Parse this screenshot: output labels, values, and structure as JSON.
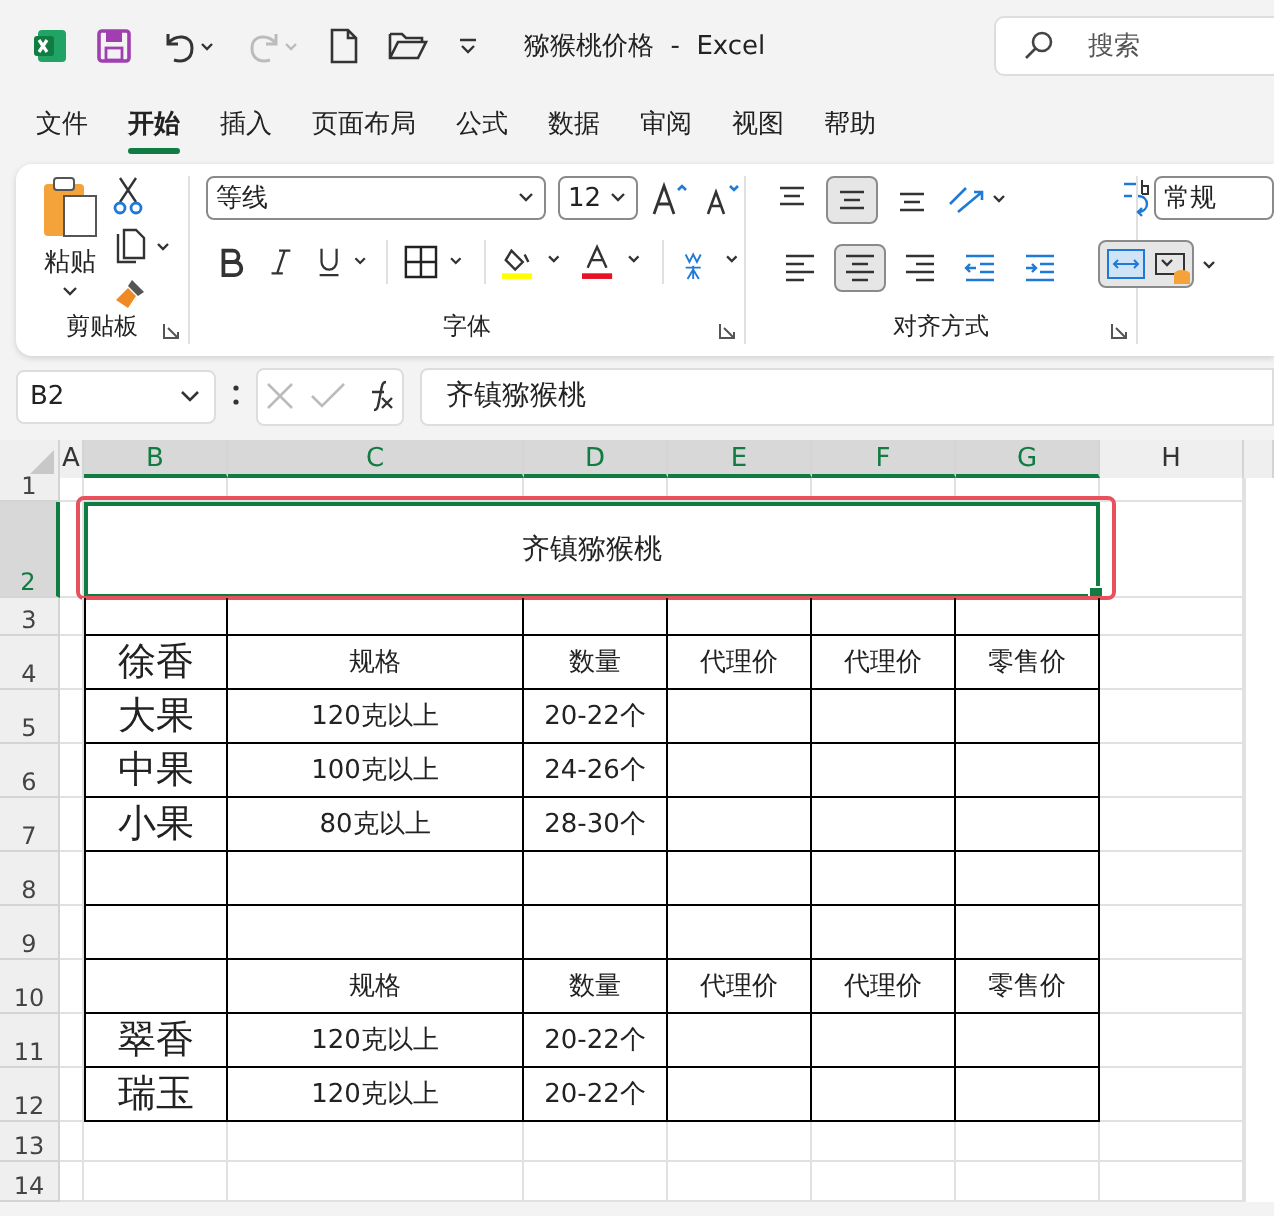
{
  "title_bar": {
    "document": "猕猴桃价格",
    "separator": "-",
    "app": "Excel",
    "search": {
      "placeholder": "搜索"
    }
  },
  "menu_tabs": [
    {
      "label": "文件",
      "selected": false
    },
    {
      "label": "开始",
      "selected": true
    },
    {
      "label": "插入",
      "selected": false
    },
    {
      "label": "页面布局",
      "selected": false
    },
    {
      "label": "公式",
      "selected": false
    },
    {
      "label": "数据",
      "selected": false
    },
    {
      "label": "审阅",
      "selected": false
    },
    {
      "label": "视图",
      "selected": false
    },
    {
      "label": "帮助",
      "selected": false
    }
  ],
  "ribbon": {
    "clipboard": {
      "paste": "粘贴",
      "group": "剪贴板"
    },
    "font": {
      "name": "等线",
      "size": "12",
      "group": "字体"
    },
    "alignment": {
      "group": "对齐方式",
      "vertical": [
        {
          "kind": "top",
          "selected": false
        },
        {
          "kind": "middle",
          "selected": true
        },
        {
          "kind": "bottom",
          "selected": false
        }
      ],
      "horizontal": [
        {
          "kind": "left",
          "selected": false
        },
        {
          "kind": "center",
          "selected": true
        },
        {
          "kind": "right",
          "selected": false
        },
        {
          "kind": "outdent",
          "selected": false
        },
        {
          "kind": "indent",
          "selected": false
        }
      ],
      "merge": {
        "selected": true
      }
    },
    "number": {
      "format": "常规"
    }
  },
  "formula_bar": {
    "name_box": "B2",
    "value": "齐镇猕猴桃"
  },
  "sheet": {
    "columns": [
      {
        "label": "A",
        "selected": false
      },
      {
        "label": "B",
        "selected": true
      },
      {
        "label": "C",
        "selected": true
      },
      {
        "label": "D",
        "selected": true
      },
      {
        "label": "E",
        "selected": true
      },
      {
        "label": "F",
        "selected": true
      },
      {
        "label": "G",
        "selected": true
      },
      {
        "label": "H",
        "selected": false
      }
    ],
    "rows": [
      {
        "number": "1",
        "selected": false,
        "bordered": false,
        "cells": [
          null,
          null,
          null,
          null,
          null,
          null
        ]
      },
      {
        "number": "2",
        "selected": true,
        "highlight": true,
        "merged": "齐镇猕猴桃"
      },
      {
        "number": "3",
        "selected": false,
        "bordered": true,
        "cells": [
          null,
          null,
          null,
          null,
          null,
          null
        ]
      },
      {
        "number": "4",
        "selected": false,
        "bordered": true,
        "cells": [
          {
            "text": "徐香",
            "large": true
          },
          {
            "text": "规格",
            "large": false
          },
          {
            "text": "数量",
            "large": false
          },
          {
            "text": "代理价",
            "large": false
          },
          {
            "text": "代理价",
            "large": false
          },
          {
            "text": "零售价",
            "large": false
          }
        ]
      },
      {
        "number": "5",
        "selected": false,
        "bordered": true,
        "cells": [
          {
            "text": "大果",
            "large": true
          },
          {
            "text": "120克以上",
            "large": false
          },
          {
            "text": "20-22个",
            "large": false
          },
          null,
          null,
          null
        ]
      },
      {
        "number": "6",
        "selected": false,
        "bordered": true,
        "cells": [
          {
            "text": "中果",
            "large": true
          },
          {
            "text": "100克以上",
            "large": false
          },
          {
            "text": "24-26个",
            "large": false
          },
          null,
          null,
          null
        ]
      },
      {
        "number": "7",
        "selected": false,
        "bordered": true,
        "cells": [
          {
            "text": "小果",
            "large": true
          },
          {
            "text": "80克以上",
            "large": false
          },
          {
            "text": "28-30个",
            "large": false
          },
          null,
          null,
          null
        ]
      },
      {
        "number": "8",
        "selected": false,
        "bordered": true,
        "cells": [
          null,
          null,
          null,
          null,
          null,
          null
        ]
      },
      {
        "number": "9",
        "selected": false,
        "bordered": true,
        "cells": [
          null,
          null,
          null,
          null,
          null,
          null
        ]
      },
      {
        "number": "10",
        "selected": false,
        "bordered": true,
        "cells": [
          null,
          {
            "text": "规格",
            "large": false
          },
          {
            "text": "数量",
            "large": false
          },
          {
            "text": "代理价",
            "large": false
          },
          {
            "text": "代理价",
            "large": false
          },
          {
            "text": "零售价",
            "large": false
          }
        ]
      },
      {
        "number": "11",
        "selected": false,
        "bordered": true,
        "cells": [
          {
            "text": "翠香",
            "large": true
          },
          {
            "text": "120克以上",
            "large": false
          },
          {
            "text": "20-22个",
            "large": false
          },
          null,
          null,
          null
        ]
      },
      {
        "number": "12",
        "selected": false,
        "bordered": true,
        "cells": [
          {
            "text": "瑞玉",
            "large": true
          },
          {
            "text": "120克以上",
            "large": false
          },
          {
            "text": "20-22个",
            "large": false
          },
          null,
          null,
          null
        ]
      },
      {
        "number": "13",
        "selected": false,
        "bordered": false,
        "cells": [
          null,
          null,
          null,
          null,
          null,
          null
        ]
      },
      {
        "number": "14",
        "selected": false,
        "bordered": false,
        "cells": [
          null,
          null,
          null,
          null,
          null,
          null
        ]
      }
    ]
  }
}
